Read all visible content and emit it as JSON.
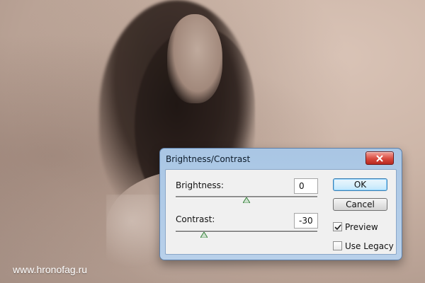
{
  "background": {
    "watermark_text": "www.hronofag.ru"
  },
  "dialog": {
    "title": "Brightness/Contrast",
    "brightness": {
      "label": "Brightness:",
      "value": "0",
      "slider_fraction": 0.5
    },
    "contrast": {
      "label": "Contrast:",
      "value": "-30",
      "slider_fraction": 0.2
    },
    "buttons": {
      "ok_label": "OK",
      "cancel_label": "Cancel"
    },
    "options": {
      "preview_label": "Preview",
      "preview_checked": true,
      "legacy_label": "Use Legacy",
      "legacy_checked": false
    },
    "icons": {
      "close": "close-icon",
      "slider_thumb": "triangle-up-icon",
      "checkmark": "checkmark-icon"
    },
    "colors": {
      "thumb_green": "#2e7d32",
      "ok_blue": "#3c7fb1",
      "close_red": "#d84a3e"
    }
  }
}
